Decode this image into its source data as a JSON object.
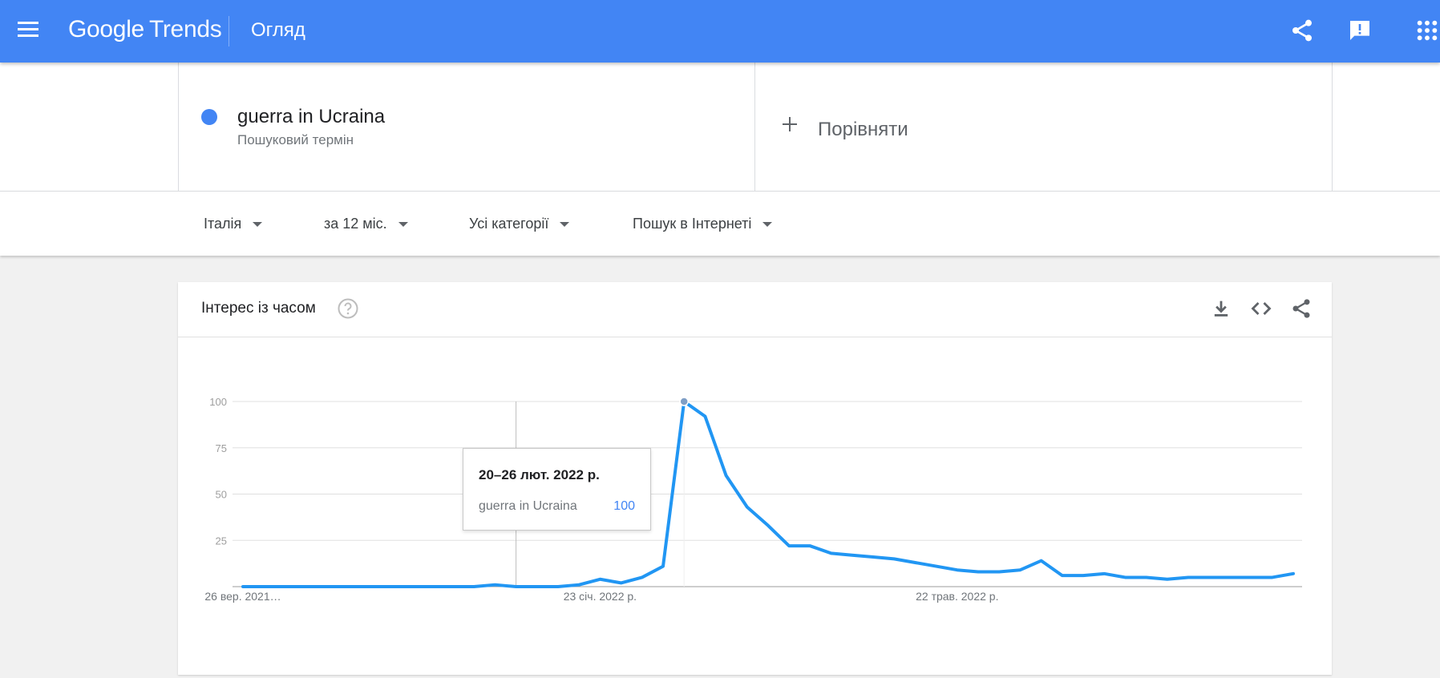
{
  "header": {
    "logo_google": "Google",
    "logo_trends": "Trends",
    "title": "Огляд",
    "icons": [
      "menu-icon",
      "share-icon",
      "feedback-icon",
      "apps-icon"
    ]
  },
  "terms": {
    "term": {
      "name": "guerra in Ucraina",
      "type": "Пошуковий термін",
      "color": "#4285f4"
    },
    "compare_label": "Порівняти"
  },
  "filters": {
    "region": "Італія",
    "period": "за 12 міс.",
    "category": "Усі категорії",
    "search_type": "Пошук в Інтернеті"
  },
  "card": {
    "title": "Інтерес із часом",
    "icons": [
      "help-icon",
      "download-icon",
      "embed-icon",
      "share-icon"
    ]
  },
  "tooltip": {
    "date": "20–26 лют. 2022 р.",
    "term": "guerra in Ucraina",
    "value": "100"
  },
  "chart_data": {
    "type": "line",
    "series": [
      {
        "name": "guerra in Ucraina",
        "color": "#2196f3",
        "values": [
          0,
          0,
          0,
          0,
          0,
          0,
          0,
          0,
          0,
          0,
          0,
          0,
          1,
          0,
          0,
          0,
          1,
          4,
          2,
          5,
          11,
          100,
          92,
          60,
          43,
          33,
          22,
          22,
          18,
          17,
          16,
          15,
          13,
          11,
          9,
          8,
          8,
          9,
          14,
          6,
          6,
          7,
          5,
          5,
          4,
          5,
          5,
          5,
          5,
          5,
          7
        ]
      }
    ],
    "x_tick_labels": [
      {
        "label": "26 вер. 2021…",
        "index": 0
      },
      {
        "label": "23 січ. 2022 р.",
        "index": 17
      },
      {
        "label": "22 трав. 2022 р.",
        "index": 34
      }
    ],
    "y_ticks": [
      100,
      75,
      50,
      25
    ],
    "ylim": [
      0,
      100
    ],
    "grid": true,
    "highlight_index": 21,
    "hover_index": 13
  }
}
